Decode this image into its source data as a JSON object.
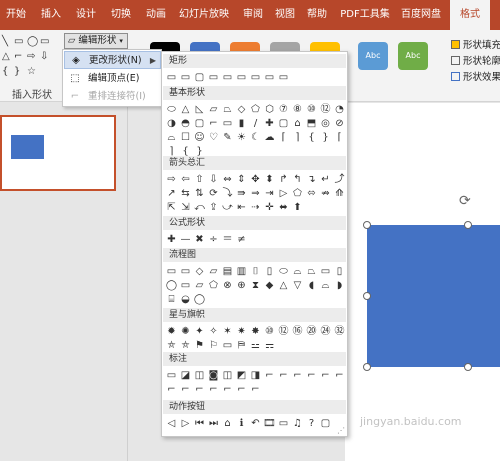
{
  "ribbon": {
    "tabs": [
      "开始",
      "插入",
      "设计",
      "切换",
      "动画",
      "幻灯片放映",
      "审阅",
      "视图",
      "帮助",
      "PDF工具集",
      "百度网盘",
      "格式"
    ],
    "active_tab": "格式",
    "edit_shape_label": "编辑形状",
    "insert_shapes_group_label": "插入形状",
    "style_swatch_label": "Abc",
    "shape_fill_label": "形状填充",
    "shape_outline_label": "形状轮廓",
    "shape_effects_label": "形状效果",
    "colors": {
      "accent": "#b7472a",
      "blue": "#4472c4",
      "green": "#70ad47",
      "gold": "#ffc000",
      "gray": "#a5a5a5"
    }
  },
  "edit_shape_menu": {
    "items": [
      {
        "label": "更改形状(N)",
        "icon": "change-shape-icon",
        "state": "hover"
      },
      {
        "label": "编辑顶点(E)",
        "icon": "edit-points-icon",
        "state": "normal"
      },
      {
        "label": "重排连接符(I)",
        "icon": "reroute-connectors-icon",
        "state": "disabled"
      }
    ]
  },
  "shape_gallery": {
    "categories": [
      {
        "name": "矩形",
        "shapes": [
          "▭",
          "▭",
          "▢",
          "▭",
          "▭",
          "▭",
          "▭",
          "▭",
          "▭"
        ]
      },
      {
        "name": "基本形状",
        "shapes": [
          "⬭",
          "△",
          "◺",
          "▱",
          "⏢",
          "◇",
          "⬠",
          "⬡",
          "⑦",
          "⑧",
          "⑩",
          "⑫",
          "◔",
          "◑",
          "◓",
          "▢",
          "⌐",
          "▭",
          "▮",
          "/",
          "✚",
          "▢",
          "⌂",
          "⬒",
          "◎",
          "⊘",
          "⌓",
          "☐",
          "☺",
          "♡",
          "✎",
          "☀",
          "☾",
          "☁",
          "⌈",
          "⌉",
          "{",
          "}",
          "⌈",
          "⌉",
          "{",
          "}"
        ]
      },
      {
        "name": "箭头总汇",
        "shapes": [
          "⇨",
          "⇦",
          "⇧",
          "⇩",
          "⇔",
          "⇕",
          "✥",
          "⬍",
          "↱",
          "↰",
          "↴",
          "↵",
          "⤴",
          "↗",
          "⇆",
          "⇅",
          "⟳",
          "⤵",
          "⇛",
          "⇒",
          "⇥",
          "▷",
          "⬠",
          "⬄",
          "⇏",
          "⟰",
          "⇱",
          "⇲",
          "⤺",
          "⇪",
          "⤻",
          "⇤",
          "⇢",
          "✛",
          "⬌",
          "⬆"
        ]
      },
      {
        "name": "公式形状",
        "shapes": [
          "✚",
          "—",
          "✖",
          "÷",
          "＝",
          "≠"
        ]
      },
      {
        "name": "流程图",
        "shapes": [
          "▭",
          "▭",
          "◇",
          "▱",
          "▤",
          "▥",
          "⌷",
          "▯",
          "⬭",
          "⌓",
          "⏢",
          "▭",
          "▯",
          "◯",
          "▭",
          "▱",
          "⬠",
          "⊗",
          "⊕",
          "⧗",
          "◆",
          "△",
          "▽",
          "◖",
          "⌓",
          "◗",
          "⌸",
          "◒",
          "◯"
        ]
      },
      {
        "name": "星与旗帜",
        "shapes": [
          "✹",
          "✺",
          "✦",
          "✧",
          "✶",
          "✷",
          "✸",
          "⑩",
          "⑫",
          "⑯",
          "⑳",
          "㉔",
          "㉜",
          "⛤",
          "⛤",
          "⚑",
          "⚐",
          "▭",
          "⛿",
          "⚍",
          "⚎"
        ]
      },
      {
        "name": "标注",
        "shapes": [
          "▭",
          "◪",
          "◫",
          "◙",
          "◫",
          "◩",
          "◨",
          "⌐",
          "⌐",
          "⌐",
          "⌐",
          "⌐",
          "⌐",
          "⌐",
          "⌐",
          "⌐",
          "⌐",
          "⌐",
          "⌐",
          "⌐"
        ]
      },
      {
        "name": "动作按钮",
        "shapes": [
          "◁",
          "▷",
          "⏮",
          "⏭",
          "⌂",
          "ℹ",
          "↶",
          "🎞",
          "▭",
          "♫",
          "?",
          "▢"
        ]
      }
    ]
  },
  "watermark": "jingyan.baidu.com"
}
